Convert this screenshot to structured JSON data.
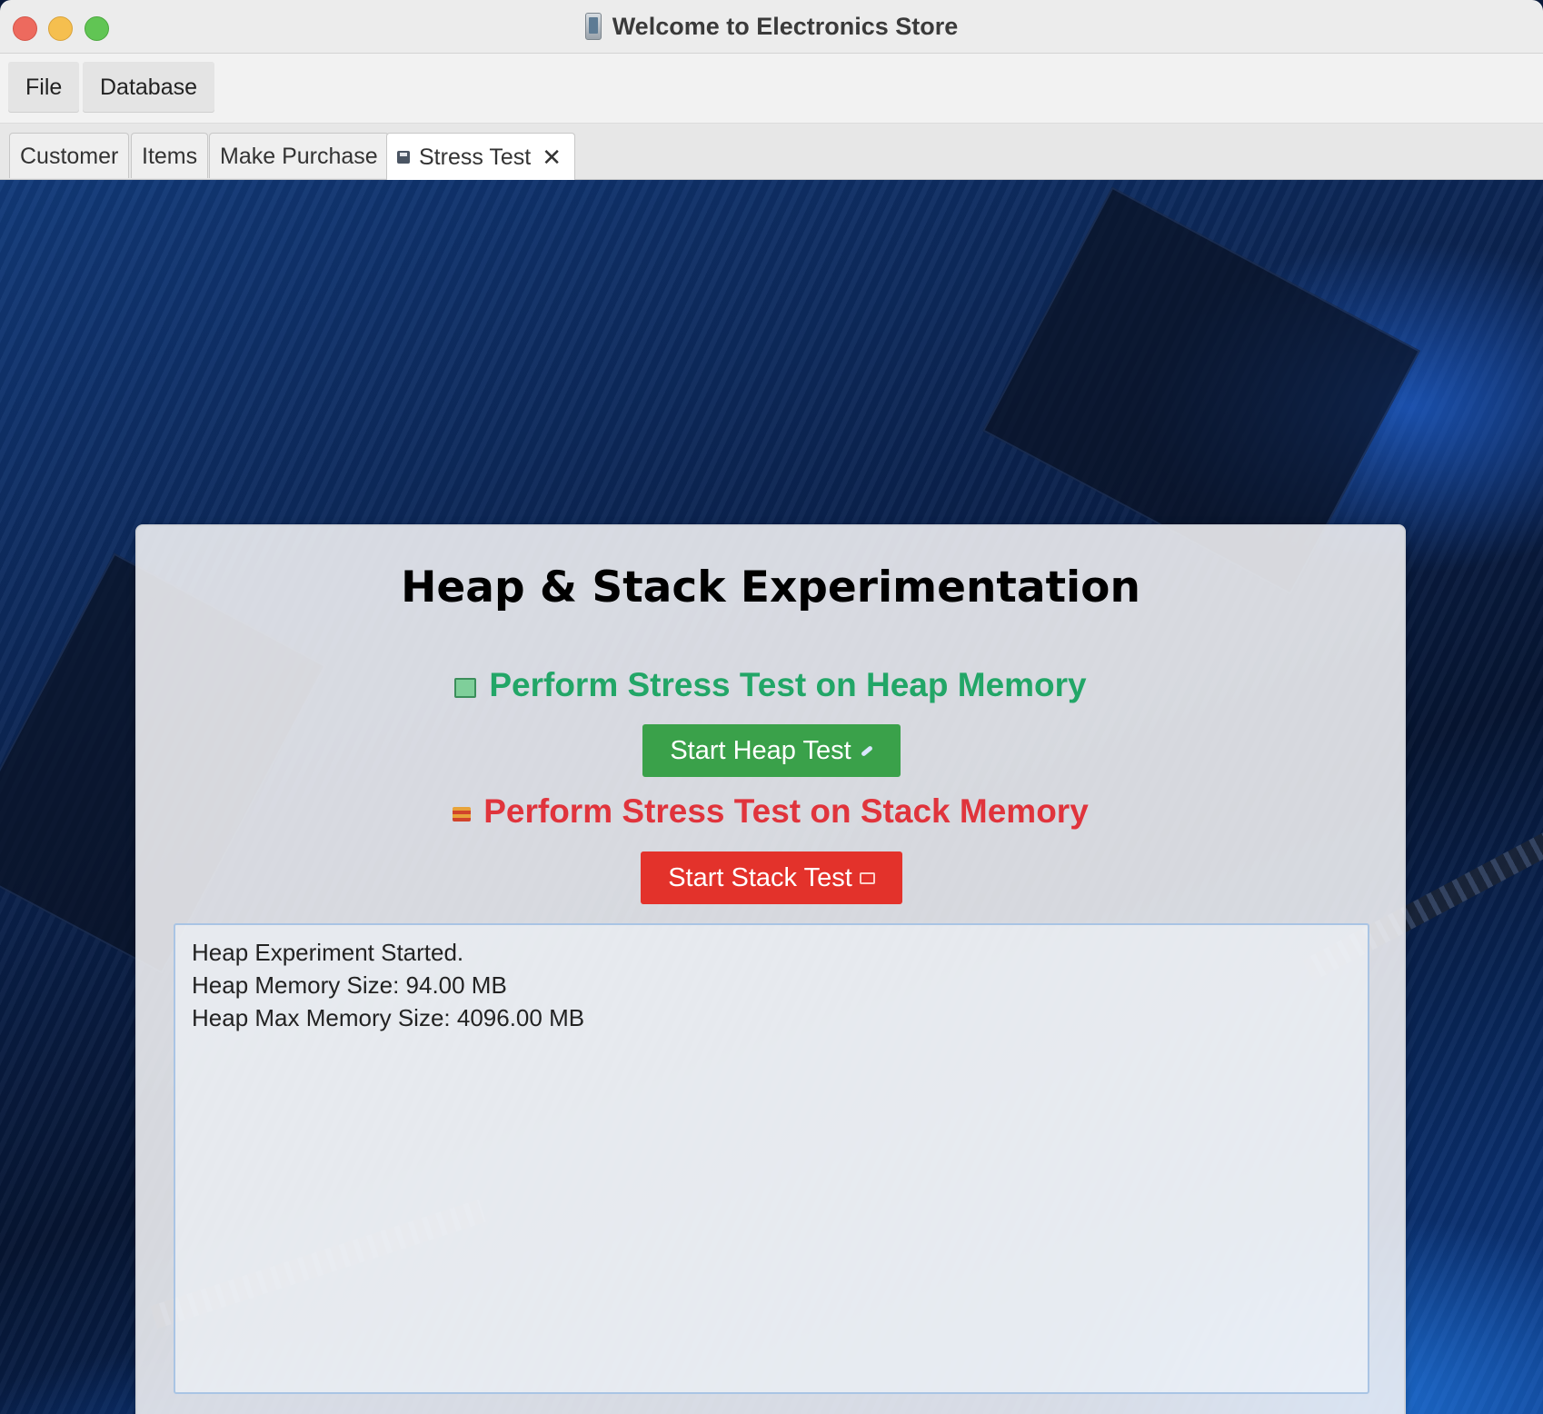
{
  "window": {
    "title": "Welcome to Electronics Store",
    "title_icon": "phone-icon"
  },
  "menu": {
    "items": [
      {
        "label": "File"
      },
      {
        "label": "Database"
      }
    ]
  },
  "tabs": {
    "items": [
      {
        "label": "Customer"
      },
      {
        "label": "Items"
      },
      {
        "label": "Make Purchase"
      },
      {
        "label": "Stress Test",
        "icon": "floppy-disk-icon",
        "close": "✕",
        "selected": true
      }
    ]
  },
  "panel": {
    "title": "Heap & Stack Experimentation",
    "heap": {
      "label": "Perform Stress Test on Heap Memory",
      "icon": "memory-icon",
      "button": "Start Heap Test",
      "button_icon": "rocket-icon"
    },
    "stack": {
      "label": "Perform Stress Test on Stack Memory",
      "icon": "stack-layers-icon",
      "button": "Start Stack Test",
      "button_icon": "stack-icon"
    },
    "output_lines": [
      "Heap Experiment Started.",
      "Heap Memory Size: 94.00 MB",
      "Heap Max Memory Size: 4096.00 MB"
    ]
  },
  "colors": {
    "heap_accent": "#22a667",
    "heap_button": "#3aa14a",
    "stack_accent": "#e0343c",
    "stack_button": "#e3322b",
    "output_border": "#a9c4e4"
  }
}
